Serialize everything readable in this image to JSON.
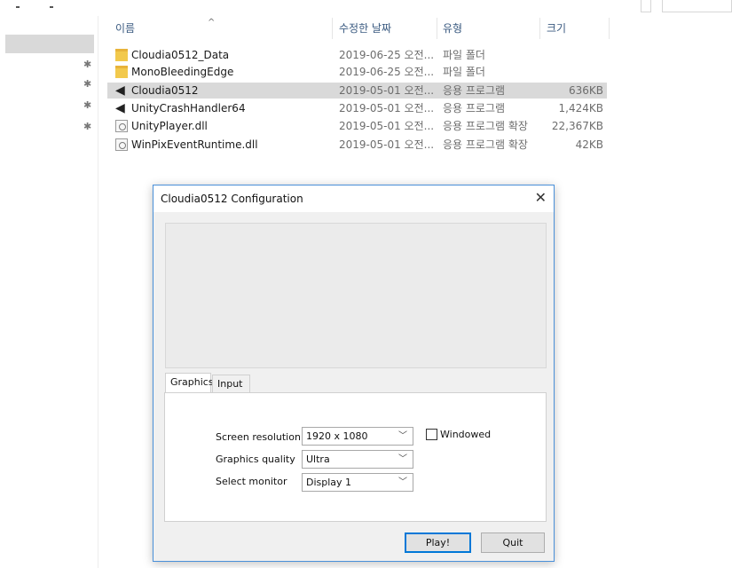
{
  "explorer": {
    "columns": {
      "name": "이름",
      "date": "수정한 날짜",
      "type": "유형",
      "size": "크기"
    },
    "files": [
      {
        "name": "Cloudia0512_Data",
        "date": "2019-06-25 오전...",
        "type": "파일 폴더",
        "size": "",
        "icon": "folder-icon"
      },
      {
        "name": "MonoBleedingEdge",
        "date": "2019-06-25 오전...",
        "type": "파일 폴더",
        "size": "",
        "icon": "folder-icon"
      },
      {
        "name": "Cloudia0512",
        "date": "2019-05-01 오전...",
        "type": "응용 프로그램",
        "size": "636KB",
        "icon": "unity-app-icon",
        "selected": true
      },
      {
        "name": "UnityCrashHandler64",
        "date": "2019-05-01 오전...",
        "type": "응용 프로그램",
        "size": "1,424KB",
        "icon": "unity-app-icon"
      },
      {
        "name": "UnityPlayer.dll",
        "date": "2019-05-01 오전...",
        "type": "응용 프로그램 확장",
        "size": "22,367KB",
        "icon": "dll-icon"
      },
      {
        "name": "WinPixEventRuntime.dll",
        "date": "2019-05-01 오전...",
        "type": "응용 프로그램 확장",
        "size": "42KB",
        "icon": "dll-icon"
      }
    ]
  },
  "dialog": {
    "title": "Cloudia0512 Configuration",
    "close": "✕",
    "tabs": [
      "Graphics",
      "Input"
    ],
    "active_tab": "Graphics",
    "fields": {
      "resolution_label": "Screen resolution",
      "resolution_value": "1920 x 1080",
      "quality_label": "Graphics quality",
      "quality_value": "Ultra",
      "monitor_label": "Select monitor",
      "monitor_value": "Display 1",
      "windowed_label": "Windowed",
      "windowed_checked": false
    },
    "buttons": {
      "play": "Play!",
      "quit": "Quit"
    }
  },
  "colors": {
    "selection": "#d9d9d9",
    "dialog_border": "#4a90d9",
    "default_button": "#0078d7"
  }
}
